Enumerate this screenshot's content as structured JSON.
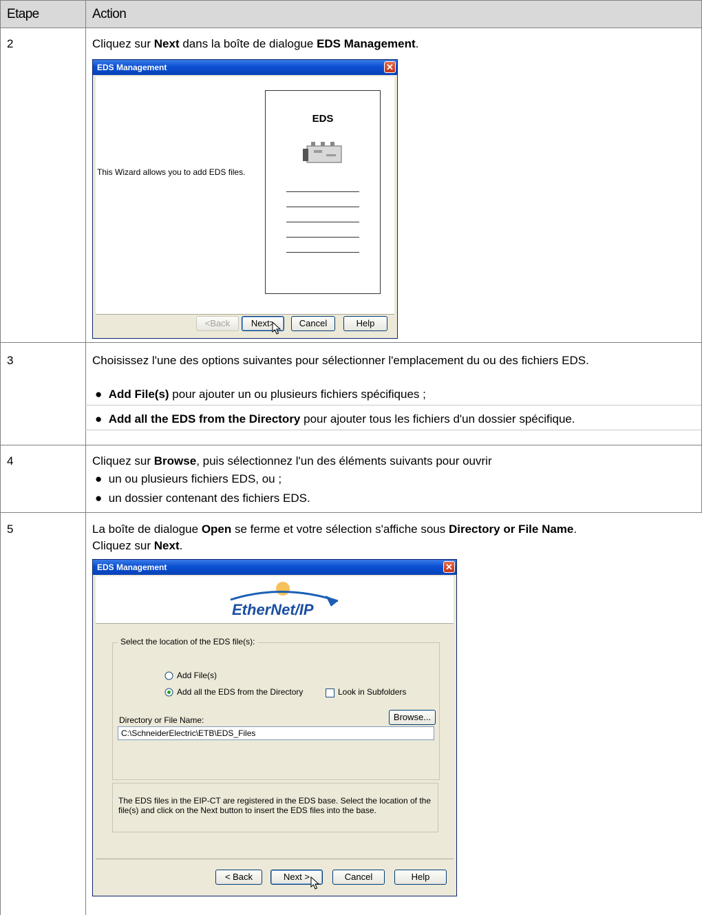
{
  "table": {
    "headers": {
      "step": "Etape",
      "action": "Action"
    },
    "rows": [
      {
        "step": "2",
        "text": {
          "a": "Cliquez sur ",
          "b": "Next",
          "c": " dans la boîte de dialogue ",
          "d": "EDS Management",
          "e": "."
        }
      },
      {
        "step": "3",
        "text": "Choisissez l'une des options suivantes pour sélectionner l'emplacement du ou des fichiers EDS.",
        "bullets": [
          {
            "bold": "Add File(s)",
            "rest": " pour ajouter un ou plusieurs fichiers spécifiques ;"
          },
          {
            "bold": "Add all the EDS from the Directory",
            "rest": " pour ajouter tous les fichiers d'un dossier spécifique."
          }
        ]
      },
      {
        "step": "4",
        "text": {
          "a": "Cliquez sur ",
          "b": "Browse",
          "c": ", puis sélectionnez l'un des éléments suivants pour ouvrir"
        },
        "bullets": [
          "un ou plusieurs fichiers EDS, ou ;",
          "un dossier contenant des fichiers EDS."
        ]
      },
      {
        "step": "5",
        "text": {
          "a": "La boîte de dialogue ",
          "b": "Open",
          "c": " se ferme et votre sélection s'affiche sous ",
          "d": "Directory or File Name",
          "e": ".",
          "f": "Cliquez sur ",
          "g": "Next",
          "h": "."
        }
      }
    ]
  },
  "dialog1": {
    "title": "EDS Management",
    "message": "This Wizard allows you to add EDS files.",
    "card_title": "EDS",
    "buttons": {
      "back": "<Back",
      "next": "Next>",
      "cancel": "Cancel",
      "help": "Help"
    }
  },
  "dialog2": {
    "title": "EDS Management",
    "logo_text": "EtherNet/IP",
    "group_label": "Select the location of the EDS file(s):",
    "radio_add_files": "Add File(s)",
    "radio_add_dir": "Add all the EDS from the Directory",
    "checkbox_subfolders": "Look in Subfolders",
    "browse": "Browse...",
    "dir_label": "Directory or File Name:",
    "dir_value": "C:\\SchneiderElectric\\ETB\\EDS_Files",
    "info": "The EDS files in the EIP-CT are registered in the EDS base. Select the location of the file(s) and click on the Next button to insert the EDS files into the base.",
    "selected_radio": "add_dir",
    "subfolders_checked": false,
    "buttons": {
      "back": "< Back",
      "next": "Next >",
      "cancel": "Cancel",
      "help": "Help"
    }
  }
}
